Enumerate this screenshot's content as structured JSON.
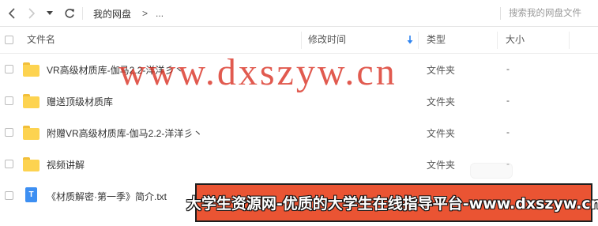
{
  "nav": {
    "breadcrumb_root": "我的网盘",
    "breadcrumb_sep": ">",
    "breadcrumb_more": "...",
    "search_placeholder": "搜索我的网盘文件"
  },
  "columns": {
    "name": "文件名",
    "mtime": "修改时间",
    "type": "类型",
    "size": "大小",
    "sorted_by": "mtime",
    "sort_direction": "descending"
  },
  "files": [
    {
      "name": "VR高级材质库-伽马2.2-洋洋彡丶",
      "type": "文件夹",
      "size": "-",
      "icon": "folder-icon"
    },
    {
      "name": "赠送顶级材质库",
      "type": "文件夹",
      "size": "-",
      "icon": "folder-icon"
    },
    {
      "name": "附赠VR高级材质库-伽马2.2-洋洋彡丶",
      "type": "文件夹",
      "size": "-",
      "icon": "folder-icon"
    },
    {
      "name": "视频讲解",
      "type": "文件夹",
      "size": "-",
      "icon": "folder-icon"
    },
    {
      "name": "《材质解密·第一季》简介.txt",
      "type": "",
      "size": "",
      "icon": "txt-file-icon",
      "icon_letter": "T"
    }
  ],
  "watermark": {
    "url_text": "www.dxszyw.cn",
    "banner_text": "大学生资源网-优质的大学生在线指导平台-www.dxszyw.cn"
  },
  "colors": {
    "folder": "#fdd350",
    "accent": "#2f84f0",
    "banner": "#ea5433",
    "watermark": "#d82c1e"
  }
}
